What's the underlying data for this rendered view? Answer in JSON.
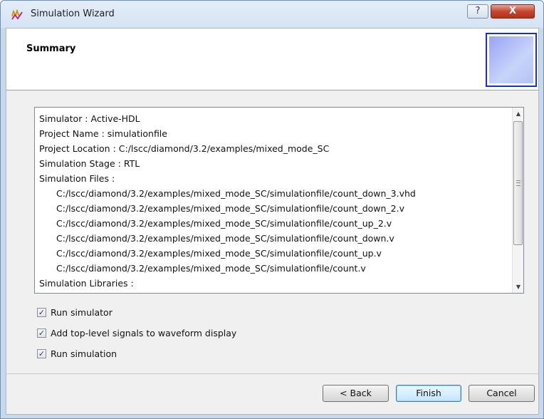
{
  "window": {
    "title": "Simulation Wizard",
    "help_glyph": "?",
    "close_glyph": "X"
  },
  "header": {
    "title": "Summary"
  },
  "summary": {
    "lines": [
      {
        "text": "Simulator : Active-HDL",
        "indent": false
      },
      {
        "text": "Project Name : simulationfile",
        "indent": false
      },
      {
        "text": "Project Location : C:/lscc/diamond/3.2/examples/mixed_mode_SC",
        "indent": false
      },
      {
        "text": "Simulation Stage : RTL",
        "indent": false
      },
      {
        "text": "Simulation Files :",
        "indent": false
      },
      {
        "text": "C:/lscc/diamond/3.2/examples/mixed_mode_SC/simulationfile/count_down_3.vhd",
        "indent": true
      },
      {
        "text": "C:/lscc/diamond/3.2/examples/mixed_mode_SC/simulationfile/count_down_2.v",
        "indent": true
      },
      {
        "text": "C:/lscc/diamond/3.2/examples/mixed_mode_SC/simulationfile/count_up_2.v",
        "indent": true
      },
      {
        "text": "C:/lscc/diamond/3.2/examples/mixed_mode_SC/simulationfile/count_down.v",
        "indent": true
      },
      {
        "text": "C:/lscc/diamond/3.2/examples/mixed_mode_SC/simulationfile/count_up.v",
        "indent": true
      },
      {
        "text": "C:/lscc/diamond/3.2/examples/mixed_mode_SC/simulationfile/count.v",
        "indent": true
      },
      {
        "text": "Simulation Libraries :",
        "indent": false
      }
    ]
  },
  "options": [
    {
      "label": "Run simulator",
      "checked": true
    },
    {
      "label": "Add top-level signals to waveform display",
      "checked": true
    },
    {
      "label": "Run simulation",
      "checked": true
    }
  ],
  "check_glyph": "✓",
  "buttons": {
    "back": "< Back",
    "finish": "Finish",
    "cancel": "Cancel"
  }
}
